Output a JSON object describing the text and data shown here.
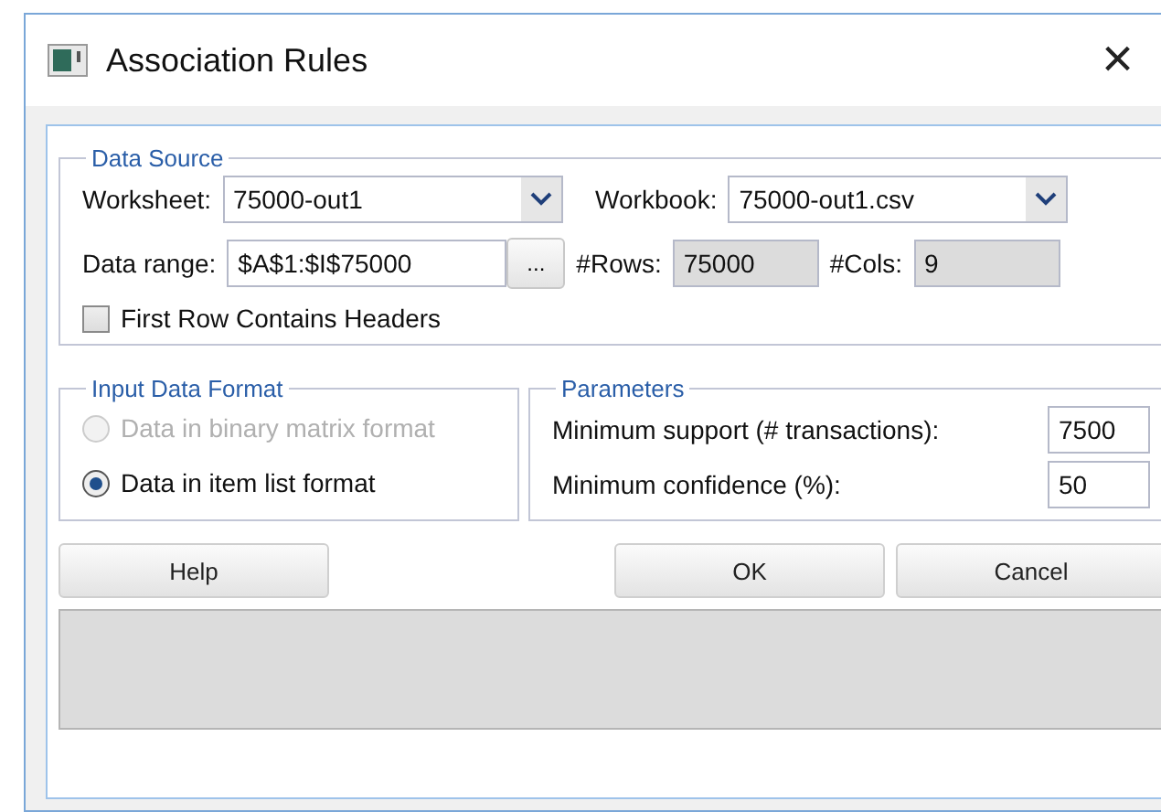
{
  "window": {
    "title": "Association Rules",
    "close": "×"
  },
  "data_source": {
    "title": "Data Source",
    "worksheet": {
      "label": "Worksheet:",
      "value": "75000-out1"
    },
    "workbook": {
      "label": "Workbook:",
      "value": "75000-out1.csv"
    },
    "data_range": {
      "label": "Data range:",
      "value": "$A$1:$I$75000",
      "browse": "..."
    },
    "rows": {
      "label": "#Rows:",
      "value": "75000"
    },
    "cols": {
      "label": "#Cols:",
      "value": "9"
    },
    "headers": {
      "label": "First Row Contains Headers",
      "checked": false
    }
  },
  "input_format": {
    "title": "Input Data Format",
    "options": [
      {
        "label": "Data in binary matrix format",
        "selected": false,
        "disabled": true
      },
      {
        "label": "Data in item list format",
        "selected": true,
        "disabled": false
      }
    ]
  },
  "parameters": {
    "title": "Parameters",
    "fields": [
      {
        "label": "Minimum support (# transactions):",
        "value": "7500"
      },
      {
        "label": "Minimum confidence (%):",
        "value": "50"
      }
    ]
  },
  "buttons": {
    "help": "Help",
    "ok": "OK",
    "cancel": "Cancel"
  }
}
